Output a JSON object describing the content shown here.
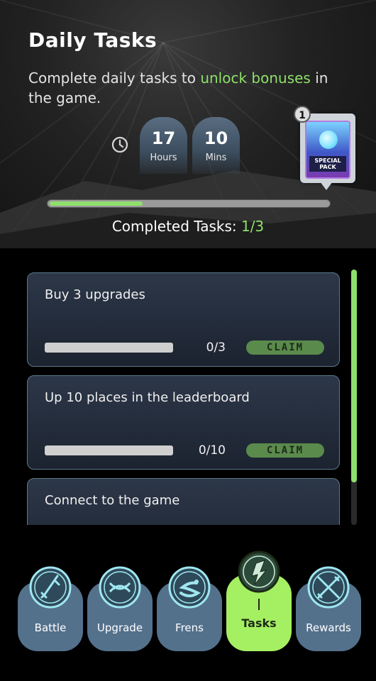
{
  "header": {
    "title": "Daily Tasks",
    "subtitle_before": "Complete daily tasks to ",
    "subtitle_highlight": "unlock bonuses",
    "subtitle_after": " in the game.",
    "timer": {
      "hours_value": "17",
      "hours_label": "Hours",
      "mins_value": "10",
      "mins_label": "Mins"
    },
    "pack": {
      "badge": "1",
      "label": "SPECIAL PACK"
    },
    "progress_fraction": 0.333,
    "completed_label": "Completed Tasks: ",
    "completed_value": "1/3"
  },
  "tasks": [
    {
      "name": "Buy 3 upgrades",
      "count": "0/3",
      "claim": "CLAIM",
      "progress": 0
    },
    {
      "name": "Up 10 places in the leaderboard",
      "count": "0/10",
      "claim": "CLAIM",
      "progress": 0
    },
    {
      "name": "Connect to the game",
      "count": "",
      "claim": "",
      "progress": 0
    }
  ],
  "nav": [
    {
      "label": "Battle",
      "icon": "dagger-icon",
      "active": false
    },
    {
      "label": "Upgrade",
      "icon": "dna-icon",
      "active": false
    },
    {
      "label": "Frens",
      "icon": "snake-icon",
      "active": false
    },
    {
      "label": "Tasks",
      "icon": "tasks-icon",
      "active": true
    },
    {
      "label": "Rewards",
      "icon": "swords-icon",
      "active": false
    }
  ],
  "colors": {
    "accent": "#a5ef62",
    "highlight_text": "#8ee06a",
    "nav_button": "#54718c",
    "claim_button": "#5a8a4c"
  }
}
